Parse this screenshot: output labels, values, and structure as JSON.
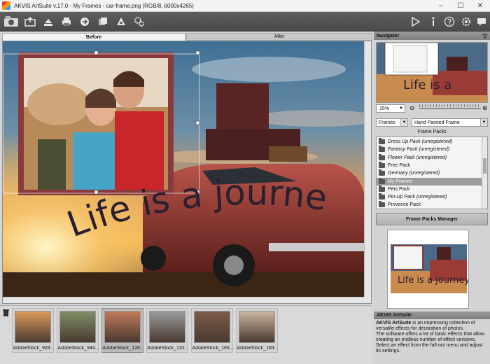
{
  "window": {
    "title": "AKVIS ArtSuite v.17.0 - My Frames - car-frame.png (RGB/8, 6000x4265)",
    "minimize": "–",
    "maximize": "☐",
    "close": "✕"
  },
  "toolbar": {
    "left_icons": [
      "open-image-icon",
      "save-image-icon",
      "print-icon",
      "share-icon",
      "batch-icon",
      "load-preset-icon",
      "save-preset-icon",
      "settings-gear-icon"
    ],
    "right_icons": [
      "run-icon",
      "info-icon",
      "help-icon",
      "preferences-icon",
      "notifications-icon"
    ]
  },
  "tabs": {
    "before": "Before",
    "after": "After"
  },
  "canvas": {
    "text_overlay": "Life is a journey"
  },
  "thumbnails": [
    {
      "label": "AdobeStock_928...",
      "selected": false
    },
    {
      "label": "AdobeStock_944...",
      "selected": false
    },
    {
      "label": "AdobeStock_128...",
      "selected": true
    },
    {
      "label": "AdobeStock_132...",
      "selected": false
    },
    {
      "label": "AdobeStock_165...",
      "selected": false
    },
    {
      "label": "AdobeStock_183...",
      "selected": false
    }
  ],
  "navigator": {
    "title": "Navigator",
    "zoom": "15%",
    "zoom_out": "⊖",
    "zoom_in": "⊕"
  },
  "controls": {
    "category": "Frames",
    "effect": "Hand Painted Frame"
  },
  "frame_packs": {
    "title": "Frame Packs",
    "items": [
      {
        "label": "Dress Up Pack (unregistered)",
        "italic": true,
        "selected": false
      },
      {
        "label": "Fantasy Pack (unregistered)",
        "italic": true,
        "selected": false
      },
      {
        "label": "Flower Pack (unregistered)",
        "italic": true,
        "selected": false
      },
      {
        "label": "Free Pack",
        "italic": false,
        "selected": false
      },
      {
        "label": "Germany (unregistered)",
        "italic": true,
        "selected": false
      },
      {
        "label": "My Frames",
        "italic": false,
        "selected": true
      },
      {
        "label": "Pets Pack",
        "italic": false,
        "selected": false
      },
      {
        "label": "Pin-Up Pack (unregistered)",
        "italic": true,
        "selected": false
      },
      {
        "label": "Provence Pack",
        "italic": false,
        "selected": false
      }
    ],
    "manager_button": "Frame Packs Manager"
  },
  "info": {
    "title": "AKVIS ArtSuite",
    "lead": "AKVIS ArtSuite",
    "text1": " is an impressing collection of versatile effects for decoration of photos.",
    "text2": "The software offers a lot of basic effects that allow creating an endless number of effect versions.",
    "text3": "Select an effect from the fall-out menu and adjust its settings."
  },
  "colors": {
    "frame": "#8a3a3c",
    "toolbar": "#535353",
    "selected_item": "#9c9c9c"
  }
}
